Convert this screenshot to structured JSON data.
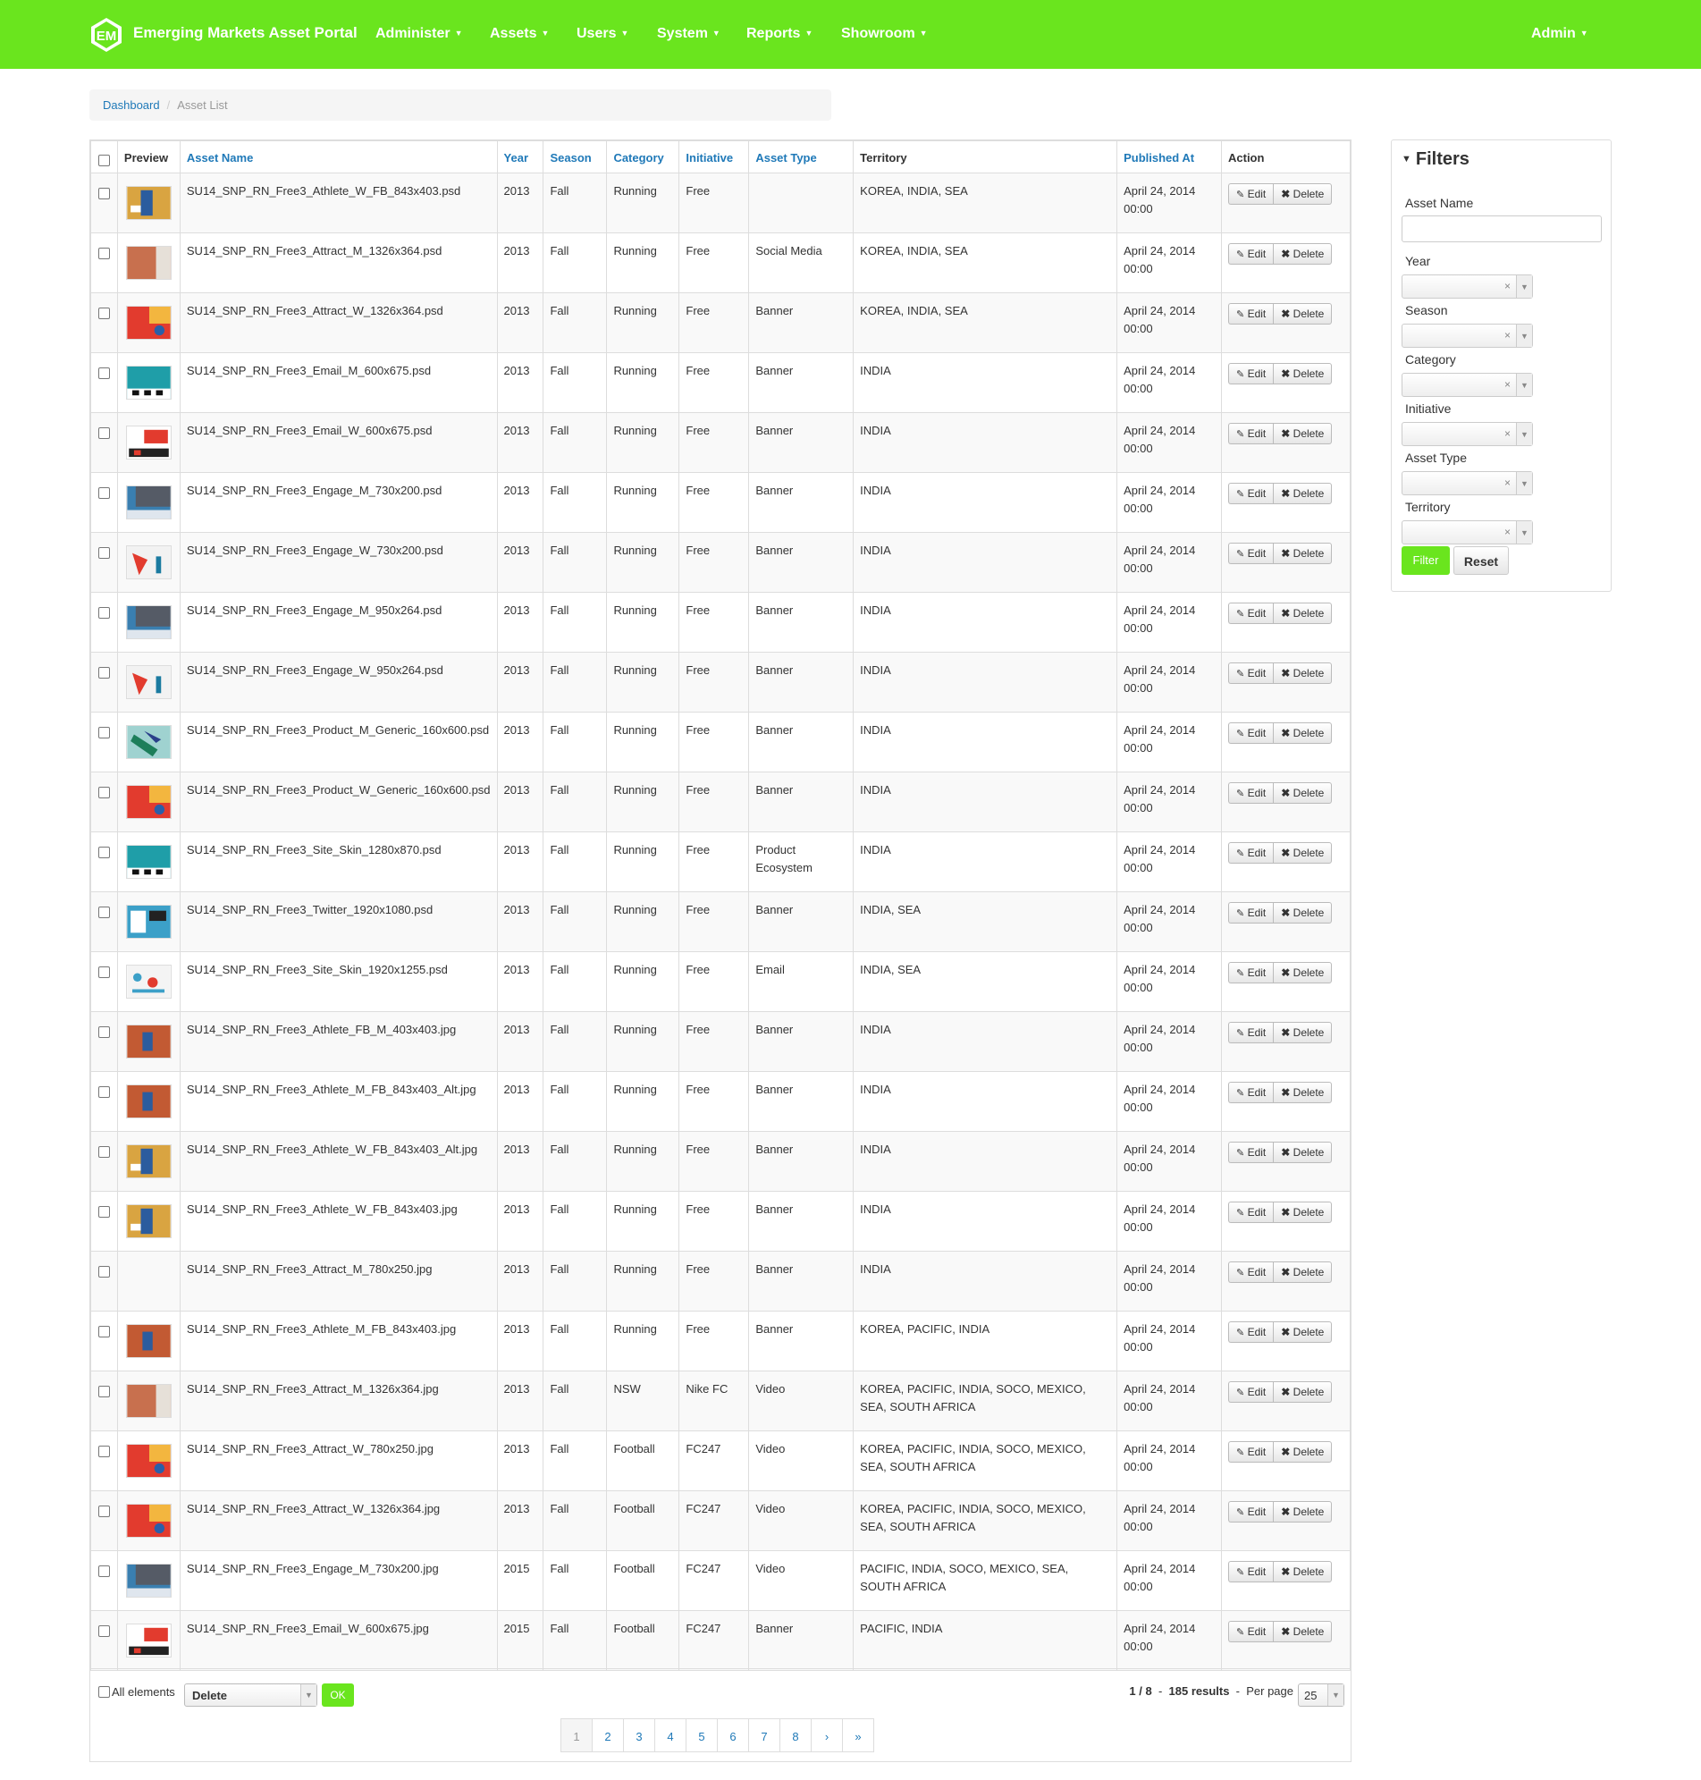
{
  "brand": "Emerging Markets Asset Portal",
  "nav": [
    "Administer",
    "Assets",
    "Users",
    "System",
    "Reports",
    "Showroom"
  ],
  "user": "Admin",
  "breadcrumb": {
    "home": "Dashboard",
    "current": "Asset List"
  },
  "columns": [
    "Preview",
    "Asset Name",
    "Year",
    "Season",
    "Category",
    "Initiative",
    "Asset Type",
    "Territory",
    "Published At",
    "Action"
  ],
  "rows": [
    {
      "name": "SU14_SNP_RN_Free3_Athlete_W_FB_843x403.psd",
      "year": "2013",
      "season": "Fall",
      "category": "Running",
      "initiative": "Free",
      "type": "",
      "territory": "KOREA, INDIA, SEA",
      "pub1": "April 24, 2014",
      "pub2": "00:00",
      "thumb": "orange"
    },
    {
      "name": "SU14_SNP_RN_Free3_Attract_M_1326x364.psd",
      "year": "2013",
      "season": "Fall",
      "category": "Running",
      "initiative": "Free",
      "type": "Social Media",
      "territory": "KOREA, INDIA, SEA",
      "pub1": "April 24, 2014",
      "pub2": "00:00",
      "thumb": "clay"
    },
    {
      "name": "SU14_SNP_RN_Free3_Attract_W_1326x364.psd",
      "year": "2013",
      "season": "Fall",
      "category": "Running",
      "initiative": "Free",
      "type": "Banner",
      "territory": "KOREA, INDIA, SEA",
      "pub1": "April 24, 2014",
      "pub2": "00:00",
      "thumb": "red"
    },
    {
      "name": "SU14_SNP_RN_Free3_Email_M_600x675.psd",
      "year": "2013",
      "season": "Fall",
      "category": "Running",
      "initiative": "Free",
      "type": "Banner",
      "territory": "INDIA",
      "pub1": "April 24, 2014",
      "pub2": "00:00",
      "thumb": "teal"
    },
    {
      "name": "SU14_SNP_RN_Free3_Email_W_600x675.psd",
      "year": "2013",
      "season": "Fall",
      "category": "Running",
      "initiative": "Free",
      "type": "Banner",
      "territory": "INDIA",
      "pub1": "April 24, 2014",
      "pub2": "00:00",
      "thumb": "redwhite"
    },
    {
      "name": "SU14_SNP_RN_Free3_Engage_M_730x200.psd",
      "year": "2013",
      "season": "Fall",
      "category": "Running",
      "initiative": "Free",
      "type": "Banner",
      "territory": "INDIA",
      "pub1": "April 24, 2014",
      "pub2": "00:00",
      "thumb": "blue"
    },
    {
      "name": "SU14_SNP_RN_Free3_Engage_W_730x200.psd",
      "year": "2013",
      "season": "Fall",
      "category": "Running",
      "initiative": "Free",
      "type": "Banner",
      "territory": "INDIA",
      "pub1": "April 24, 2014",
      "pub2": "00:00",
      "thumb": "whitered"
    },
    {
      "name": "SU14_SNP_RN_Free3_Engage_M_950x264.psd",
      "year": "2013",
      "season": "Fall",
      "category": "Running",
      "initiative": "Free",
      "type": "Banner",
      "territory": "INDIA",
      "pub1": "April 24, 2014",
      "pub2": "00:00",
      "thumb": "blue"
    },
    {
      "name": "SU14_SNP_RN_Free3_Engage_W_950x264.psd",
      "year": "2013",
      "season": "Fall",
      "category": "Running",
      "initiative": "Free",
      "type": "Banner",
      "territory": "INDIA",
      "pub1": "April 24, 2014",
      "pub2": "00:00",
      "thumb": "whitered"
    },
    {
      "name": "SU14_SNP_RN_Free3_Product_M_Generic_160x600.psd",
      "year": "2013",
      "season": "Fall",
      "category": "Running",
      "initiative": "Free",
      "type": "Banner",
      "territory": "INDIA",
      "pub1": "April 24, 2014",
      "pub2": "00:00",
      "thumb": "green"
    },
    {
      "name": "SU14_SNP_RN_Free3_Product_W_Generic_160x600.psd",
      "year": "2013",
      "season": "Fall",
      "category": "Running",
      "initiative": "Free",
      "type": "Banner",
      "territory": "INDIA",
      "pub1": "April 24, 2014",
      "pub2": "00:00",
      "thumb": "red"
    },
    {
      "name": "SU14_SNP_RN_Free3_Site_Skin_1280x870.psd",
      "year": "2013",
      "season": "Fall",
      "category": "Running",
      "initiative": "Free",
      "type": "Product Ecosystem",
      "territory": "INDIA",
      "pub1": "April 24, 2014",
      "pub2": "00:00",
      "thumb": "teal"
    },
    {
      "name": "SU14_SNP_RN_Free3_Twitter_1920x1080.psd",
      "year": "2013",
      "season": "Fall",
      "category": "Running",
      "initiative": "Free",
      "type": "Banner",
      "territory": "INDIA, SEA",
      "pub1": "April 24, 2014",
      "pub2": "00:00",
      "thumb": "sky"
    },
    {
      "name": "SU14_SNP_RN_Free3_Site_Skin_1920x1255.psd",
      "year": "2013",
      "season": "Fall",
      "category": "Running",
      "initiative": "Free",
      "type": "Email",
      "territory": "INDIA, SEA",
      "pub1": "April 24, 2014",
      "pub2": "00:00",
      "thumb": "white"
    },
    {
      "name": "SU14_SNP_RN_Free3_Athlete_FB_M_403x403.jpg",
      "year": "2013",
      "season": "Fall",
      "category": "Running",
      "initiative": "Free",
      "type": "Banner",
      "territory": "INDIA",
      "pub1": "April 24, 2014",
      "pub2": "00:00",
      "thumb": "rust"
    },
    {
      "name": "SU14_SNP_RN_Free3_Athlete_M_FB_843x403_Alt.jpg",
      "year": "2013",
      "season": "Fall",
      "category": "Running",
      "initiative": "Free",
      "type": "Banner",
      "territory": "INDIA",
      "pub1": "April 24, 2014",
      "pub2": "00:00",
      "thumb": "rust"
    },
    {
      "name": "SU14_SNP_RN_Free3_Athlete_W_FB_843x403_Alt.jpg",
      "year": "2013",
      "season": "Fall",
      "category": "Running",
      "initiative": "Free",
      "type": "Banner",
      "territory": "INDIA",
      "pub1": "April 24, 2014",
      "pub2": "00:00",
      "thumb": "orange"
    },
    {
      "name": "SU14_SNP_RN_Free3_Athlete_W_FB_843x403.jpg",
      "year": "2013",
      "season": "Fall",
      "category": "Running",
      "initiative": "Free",
      "type": "Banner",
      "territory": "INDIA",
      "pub1": "April 24, 2014",
      "pub2": "00:00",
      "thumb": "orange"
    },
    {
      "name": "SU14_SNP_RN_Free3_Attract_M_780x250.jpg",
      "year": "2013",
      "season": "Fall",
      "category": "Running",
      "initiative": "Free",
      "type": "Banner",
      "territory": "INDIA",
      "pub1": "April 24, 2014",
      "pub2": "00:00",
      "thumb": "none"
    },
    {
      "name": "SU14_SNP_RN_Free3_Athlete_M_FB_843x403.jpg",
      "year": "2013",
      "season": "Fall",
      "category": "Running",
      "initiative": "Free",
      "type": "Banner",
      "territory": "KOREA, PACIFIC, INDIA",
      "pub1": "April 24, 2014",
      "pub2": "00:00",
      "thumb": "rust"
    },
    {
      "name": "SU14_SNP_RN_Free3_Attract_M_1326x364.jpg",
      "year": "2013",
      "season": "Fall",
      "category": "NSW",
      "initiative": "Nike FC",
      "type": "Video",
      "territory": "KOREA, PACIFIC, INDIA, SOCO, MEXICO, SEA, SOUTH AFRICA",
      "pub1": "April 24, 2014",
      "pub2": "00:00",
      "thumb": "clay"
    },
    {
      "name": "SU14_SNP_RN_Free3_Attract_W_780x250.jpg",
      "year": "2013",
      "season": "Fall",
      "category": "Football",
      "initiative": "FC247",
      "type": "Video",
      "territory": "KOREA, PACIFIC, INDIA, SOCO, MEXICO, SEA, SOUTH AFRICA",
      "pub1": "April 24, 2014",
      "pub2": "00:00",
      "thumb": "red"
    },
    {
      "name": "SU14_SNP_RN_Free3_Attract_W_1326x364.jpg",
      "year": "2013",
      "season": "Fall",
      "category": "Football",
      "initiative": "FC247",
      "type": "Video",
      "territory": "KOREA, PACIFIC, INDIA, SOCO, MEXICO, SEA, SOUTH AFRICA",
      "pub1": "April 24, 2014",
      "pub2": "00:00",
      "thumb": "red"
    },
    {
      "name": "SU14_SNP_RN_Free3_Engage_M_730x200.jpg",
      "year": "2015",
      "season": "Fall",
      "category": "Football",
      "initiative": "FC247",
      "type": "Video",
      "territory": "PACIFIC, INDIA, SOCO, MEXICO, SEA, SOUTH AFRICA",
      "pub1": "April 24, 2014",
      "pub2": "00:00",
      "thumb": "blue"
    },
    {
      "name": "SU14_SNP_RN_Free3_Email_W_600x675.jpg",
      "year": "2015",
      "season": "Fall",
      "category": "Football",
      "initiative": "FC247",
      "type": "Banner",
      "territory": "PACIFIC, INDIA",
      "pub1": "April 24, 2014",
      "pub2": "00:00",
      "thumb": "redwhite"
    }
  ],
  "actions": {
    "edit": "Edit",
    "delete": "Delete"
  },
  "batch": {
    "all_label": "All elements",
    "action": "Delete",
    "ok": "OK"
  },
  "results": {
    "page": "1 / 8",
    "sep": "-",
    "count": "185 results",
    "per_page_label": "Per page",
    "per_page": "25"
  },
  "pagination": [
    "1",
    "2",
    "3",
    "4",
    "5",
    "6",
    "7",
    "8",
    "›",
    "»"
  ],
  "filters": {
    "title": "Filters",
    "fields": [
      "Asset Name",
      "Year",
      "Season",
      "Category",
      "Initiative",
      "Asset Type",
      "Territory"
    ],
    "filter_btn": "Filter",
    "reset_btn": "Reset"
  },
  "colors": {
    "brand_green": "#6ae51e",
    "link_blue": "#1f79b8"
  }
}
